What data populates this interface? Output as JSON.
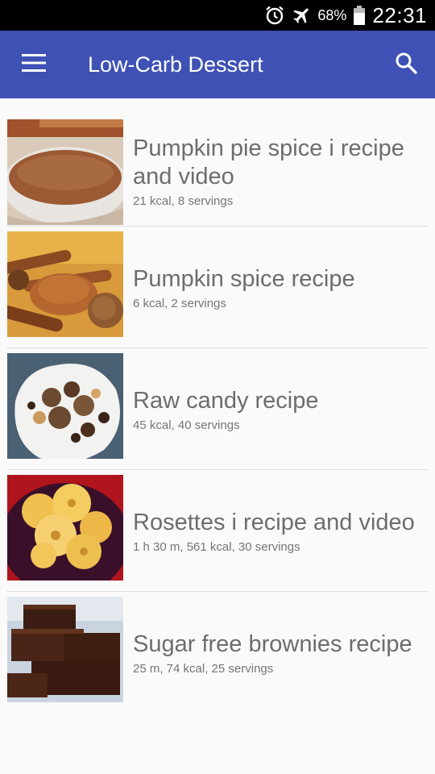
{
  "status_bar": {
    "battery": "68%",
    "time": "22:31",
    "icons": [
      "alarm-icon",
      "airplane-mode-icon",
      "battery-icon"
    ]
  },
  "app_bar": {
    "title": "Low-Carb Dessert",
    "menu_icon": "menu-icon",
    "search_icon": "search-icon"
  },
  "recipes": [
    {
      "title": "Pumpkin pie spice i recipe and video",
      "meta": "21 kcal, 8 servings",
      "image": "pumpkin-pie-spice-bowl-image"
    },
    {
      "title": "Pumpkin spice recipe",
      "meta": "6 kcal, 2 servings",
      "image": "pumpkin-spice-cinnamon-image"
    },
    {
      "title": "Raw candy recipe",
      "meta": "45 kcal, 40 servings",
      "image": "raw-candy-plate-image"
    },
    {
      "title": "Rosettes i recipe and video",
      "meta": "1 h 30 m, 561 kcal, 30 servings",
      "image": "rosettes-plate-image"
    },
    {
      "title": "Sugar free brownies recipe",
      "meta": "25 m, 74 kcal, 25 servings",
      "image": "brownies-plate-image"
    }
  ]
}
